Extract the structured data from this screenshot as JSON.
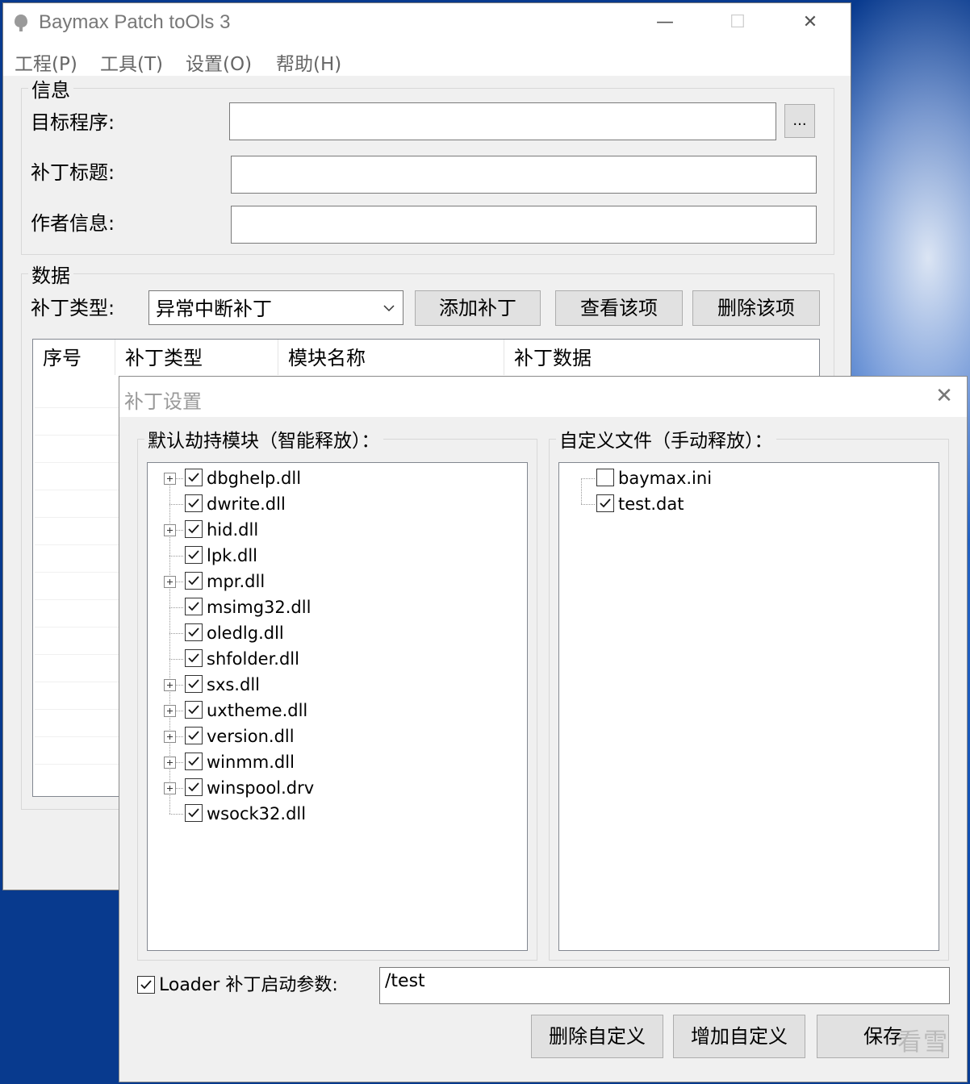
{
  "main_window": {
    "title": "Baymax Patch toOls 3",
    "controls": {
      "minimize": "—",
      "maximize": "☐",
      "close": "✕"
    },
    "menu": [
      "工程(P)",
      "工具(T)",
      "设置(O)",
      "帮助(H)"
    ],
    "info_group": {
      "legend": "信息",
      "target_label": "目标程序:",
      "target_value": "",
      "browse_label": "...",
      "patch_title_label": "补丁标题:",
      "patch_title_value": "",
      "author_label": "作者信息:",
      "author_value": ""
    },
    "data_group": {
      "legend": "数据",
      "type_label": "补丁类型:",
      "type_selected": "异常中断补丁",
      "add_button": "添加补丁",
      "view_button": "查看该项",
      "delete_button": "删除该项",
      "columns": [
        "序号",
        "补丁类型",
        "模块名称",
        "补丁数据"
      ]
    }
  },
  "dialog": {
    "title": "补丁设置",
    "close": "✕",
    "default_group_legend": "默认劫持模块（智能释放）：",
    "custom_group_legend": "自定义文件（手动释放）：",
    "default_modules": [
      {
        "name": "dbghelp.dll",
        "checked": true,
        "expandable": true
      },
      {
        "name": "dwrite.dll",
        "checked": true,
        "expandable": false
      },
      {
        "name": "hid.dll",
        "checked": true,
        "expandable": true
      },
      {
        "name": "lpk.dll",
        "checked": true,
        "expandable": false
      },
      {
        "name": "mpr.dll",
        "checked": true,
        "expandable": true
      },
      {
        "name": "msimg32.dll",
        "checked": true,
        "expandable": false
      },
      {
        "name": "oledlg.dll",
        "checked": true,
        "expandable": false
      },
      {
        "name": "shfolder.dll",
        "checked": true,
        "expandable": false
      },
      {
        "name": "sxs.dll",
        "checked": true,
        "expandable": true
      },
      {
        "name": "uxtheme.dll",
        "checked": true,
        "expandable": true
      },
      {
        "name": "version.dll",
        "checked": true,
        "expandable": true
      },
      {
        "name": "winmm.dll",
        "checked": true,
        "expandable": true
      },
      {
        "name": "winspool.drv",
        "checked": true,
        "expandable": true
      },
      {
        "name": "wsock32.dll",
        "checked": true,
        "expandable": false
      }
    ],
    "custom_files": [
      {
        "name": "baymax.ini",
        "checked": false
      },
      {
        "name": "test.dat",
        "checked": true
      }
    ],
    "loader_checked": true,
    "loader_label": "Loader 补丁启动参数:",
    "loader_value": "/test",
    "delete_custom_button": "删除自定义",
    "add_custom_button": "增加自定义",
    "save_button": "保存",
    "watermark": "看雪"
  }
}
